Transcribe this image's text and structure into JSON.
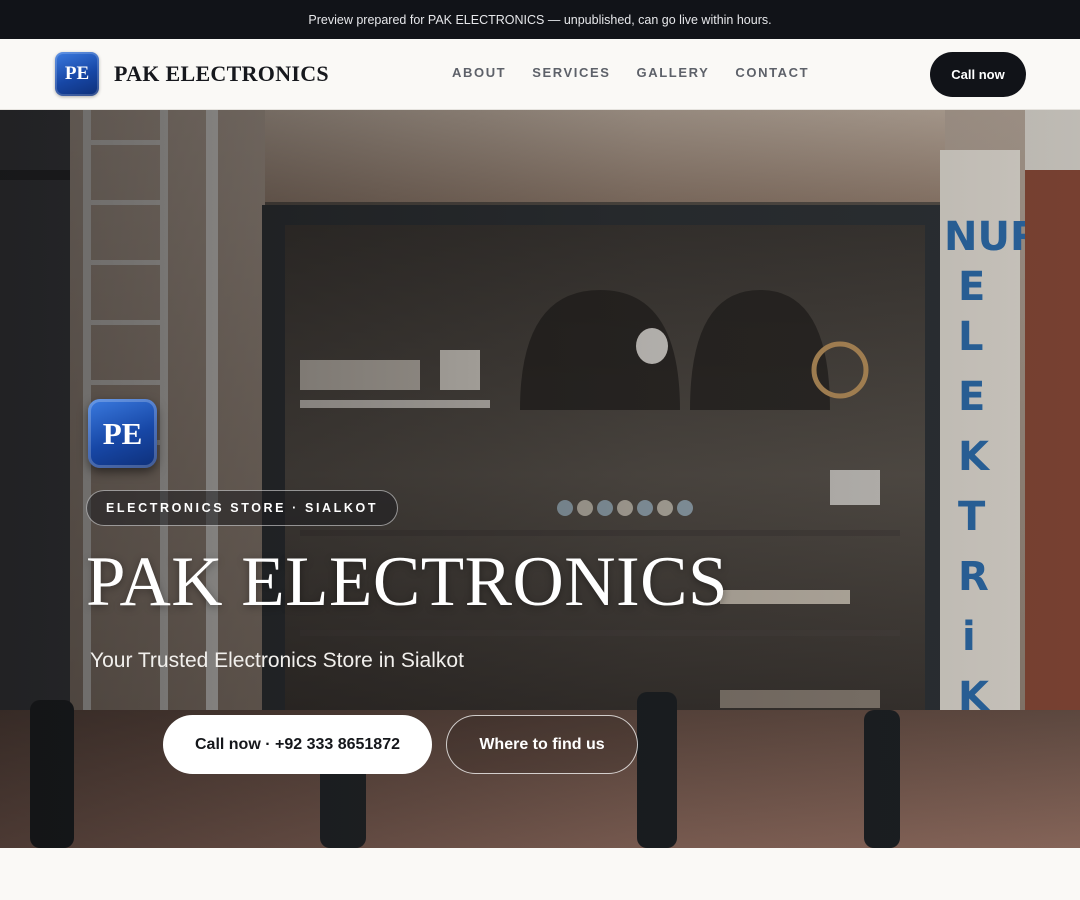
{
  "preview_banner": "Preview prepared for PAK ELECTRONICS — unpublished, can go live within hours.",
  "brand": {
    "logo_text": "PE",
    "name": "PAK ELECTRONICS",
    "logo_color": "#1747a6"
  },
  "nav": {
    "items": [
      {
        "label": "ABOUT"
      },
      {
        "label": "SERVICES"
      },
      {
        "label": "GALLERY"
      },
      {
        "label": "CONTACT"
      }
    ],
    "call_label": "Call now"
  },
  "hero": {
    "logo_text": "PE",
    "badge": "ELECTRONICS STORE · SIALKOT",
    "title": "PAK ELECTRONICS",
    "subtitle": "Your Trusted Electronics Store in Sialkot",
    "primary_button": "Call now · +92 333 8651872",
    "secondary_button": "Where to find us",
    "background_image": "storefront-photo"
  },
  "colors": {
    "top_bar": "#111318",
    "nav_background": "#faf9f6",
    "call_button": "#111318",
    "accent_blue": "#1747a6"
  }
}
